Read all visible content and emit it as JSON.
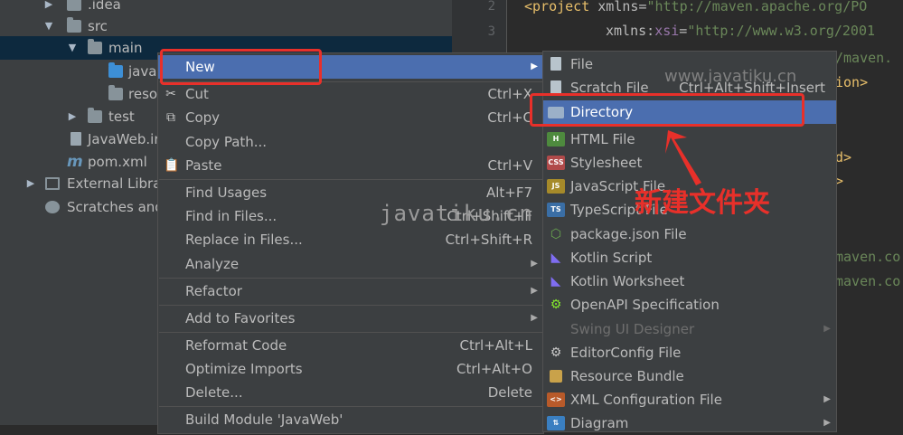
{
  "tree": {
    "items": [
      {
        "name": ".idea"
      },
      {
        "name": "src"
      },
      {
        "name": "main"
      },
      {
        "name": "java"
      },
      {
        "name": "reso"
      },
      {
        "name": "test"
      },
      {
        "name": "JavaWeb.ir"
      },
      {
        "name": "pom.xml"
      },
      {
        "name": "External Librar"
      },
      {
        "name": "Scratches and"
      }
    ]
  },
  "editor": {
    "line_numbers": [
      "2",
      "3"
    ],
    "line1": {
      "tag": "<project",
      "attr": "xmlns",
      "eq": "=",
      "val": "\"http://maven.apache.org/PO"
    },
    "line2": {
      "attr": "xmlns",
      "colon": ":",
      "ns": "xsi",
      "eq": "=",
      "val": "\"http://www.w3.org/2001"
    },
    "line3": {
      "val": "/maven."
    },
    "line4": {
      "tag": "ion>"
    },
    "line5": {
      "tag": "d>"
    },
    "line6": {
      "tag": ">"
    },
    "line7": {
      "val": "maven.co"
    },
    "line8": {
      "val": "maven.co"
    }
  },
  "context_menu": {
    "items": [
      {
        "label": "New",
        "shortcut": "",
        "arrow": "▶"
      },
      {
        "label": "Cut",
        "shortcut": "Ctrl+X"
      },
      {
        "label": "Copy",
        "shortcut": "Ctrl+C"
      },
      {
        "label": "Copy Path...",
        "shortcut": ""
      },
      {
        "label": "Paste",
        "shortcut": "Ctrl+V"
      },
      {
        "label": "Find Usages",
        "shortcut": "Alt+F7"
      },
      {
        "label": "Find in Files...",
        "shortcut": "Ctrl+Shift+F"
      },
      {
        "label": "Replace in Files...",
        "shortcut": "Ctrl+Shift+R"
      },
      {
        "label": "Analyze",
        "shortcut": "",
        "arrow": "▶"
      },
      {
        "label": "Refactor",
        "shortcut": "",
        "arrow": "▶"
      },
      {
        "label": "Add to Favorites",
        "shortcut": "",
        "arrow": "▶"
      },
      {
        "label": "Reformat Code",
        "shortcut": "Ctrl+Alt+L"
      },
      {
        "label": "Optimize Imports",
        "shortcut": "Ctrl+Alt+O"
      },
      {
        "label": "Delete...",
        "shortcut": "Delete"
      },
      {
        "label": "Build Module 'JavaWeb'",
        "shortcut": ""
      }
    ]
  },
  "submenu": {
    "items": [
      {
        "label": "File",
        "shortcut": "",
        "icon": "file-icon"
      },
      {
        "label": "Scratch File",
        "shortcut": "Ctrl+Alt+Shift+Insert",
        "icon": "scratch-file-icon"
      },
      {
        "label": "Directory",
        "shortcut": "",
        "icon": "folder-icon"
      },
      {
        "label": "HTML File",
        "shortcut": "",
        "icon": "html-file-icon"
      },
      {
        "label": "Stylesheet",
        "shortcut": "",
        "icon": "css-file-icon"
      },
      {
        "label": "JavaScript File",
        "shortcut": "",
        "icon": "js-file-icon"
      },
      {
        "label": "TypeScript File",
        "shortcut": "",
        "icon": "ts-file-icon"
      },
      {
        "label": "package.json File",
        "shortcut": "",
        "icon": "nodejs-icon"
      },
      {
        "label": "Kotlin Script",
        "shortcut": "",
        "icon": "kotlin-icon"
      },
      {
        "label": "Kotlin Worksheet",
        "shortcut": "",
        "icon": "kotlin-icon"
      },
      {
        "label": "OpenAPI Specification",
        "shortcut": "",
        "icon": "openapi-icon"
      },
      {
        "label": "Swing UI Designer",
        "shortcut": "",
        "arrow": "▶",
        "disabled": true
      },
      {
        "label": "EditorConfig File",
        "shortcut": "",
        "icon": "gear-icon"
      },
      {
        "label": "Resource Bundle",
        "shortcut": "",
        "icon": "resource-bundle-icon"
      },
      {
        "label": "XML Configuration File",
        "shortcut": "",
        "arrow": "▶",
        "icon": "xml-icon"
      },
      {
        "label": "Diagram",
        "shortcut": "",
        "arrow": "▶",
        "icon": "diagram-icon"
      }
    ]
  },
  "watermarks": {
    "center": "javatiku.cn",
    "submenu": "www.javatiku.cn"
  },
  "annotation": {
    "text": "新建文件夹",
    "color": "#e8302a"
  },
  "colors": {
    "highlight": "#4b6eaf",
    "menu_bg": "#3c3f41",
    "annotation_red": "#e8302a"
  }
}
